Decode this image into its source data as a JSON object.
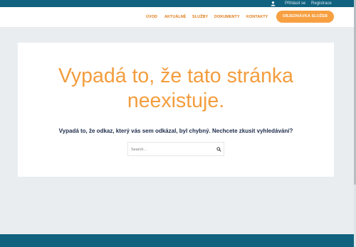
{
  "topbar": {
    "login": "Přihlásit se",
    "register": "Registrace",
    "user_icon": "user-icon"
  },
  "nav": {
    "items": [
      "ÚVOD",
      "AKTUÁLNĚ",
      "SLUŽBY",
      "DOKUMENTY",
      "KONTAKTY"
    ],
    "cta": "OBJEDNÁVKA SLUŽEB"
  },
  "main": {
    "title_line1": "Vypadá to, že tato stránka",
    "title_line2": "neexistuje.",
    "subtitle": "Vypadá to, že odkaz, který vás sem odkázal, byl chybný. Nechcete zkusit vyhledávání?",
    "search_placeholder": "Search...",
    "search_icon": "search-icon"
  },
  "colors": {
    "topbar": "#10627f",
    "accent": "#f39d3e",
    "nav_text": "#e07a16",
    "cta_bg": "#f7a041",
    "page_bg": "#e9edf0",
    "heading_dark": "#1c2b49"
  }
}
